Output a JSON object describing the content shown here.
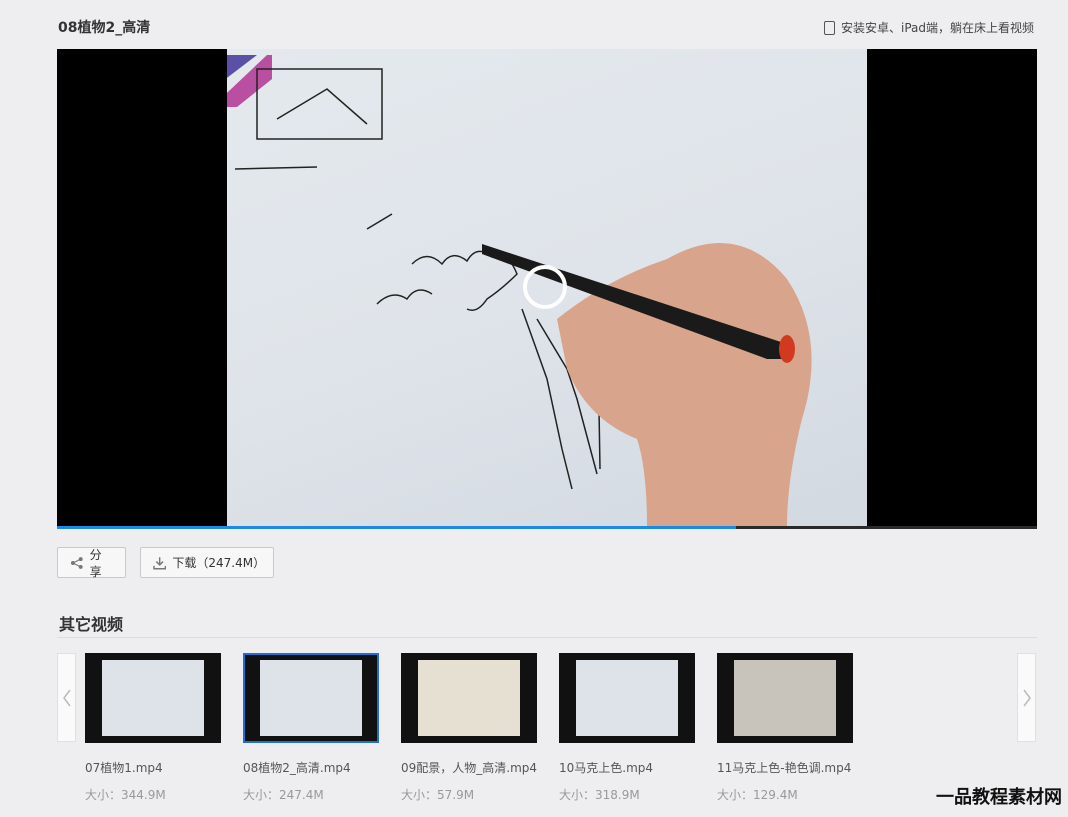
{
  "header": {
    "title": "08植物2_高清",
    "promo_text": "安装安卓、iPad端，躺在床上看视频"
  },
  "player": {
    "progress_percent": 69.3
  },
  "actions": {
    "share_label": "分享",
    "download_label": "下载（247.4M）"
  },
  "related": {
    "section_title": "其它视频",
    "items": [
      {
        "name": "07植物1.mp4",
        "size": "大小：344.9M"
      },
      {
        "name": "08植物2_高清.mp4",
        "size": "大小：247.4M",
        "active": true
      },
      {
        "name": "09配景，人物_高清.mp4",
        "size": "大小：57.9M"
      },
      {
        "name": "10马克上色.mp4",
        "size": "大小：318.9M"
      },
      {
        "name": "11马克上色-艳色调.mp4",
        "size": "大小：129.4M"
      }
    ]
  },
  "watermark": "一品教程素材网",
  "colors": {
    "accent": "#1e88e5",
    "active_border": "#1e6fd0"
  }
}
